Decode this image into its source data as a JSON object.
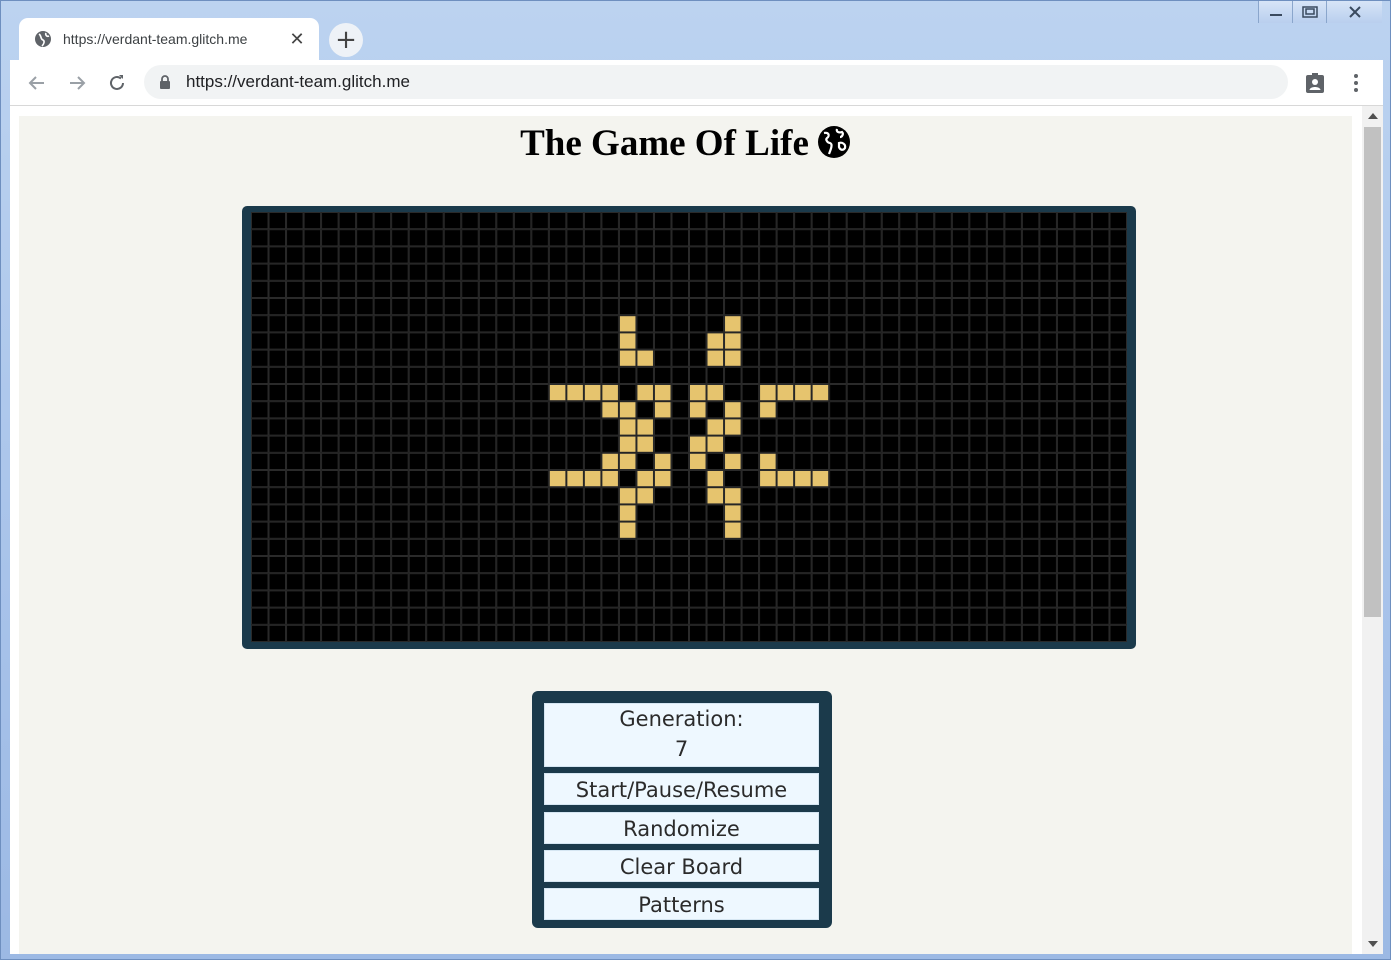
{
  "browser": {
    "tab_title": "https://verdant-team.glitch.me",
    "close_tab_glyph": "✕",
    "new_tab_glyph": "+",
    "url": "https://verdant-team.glitch.me",
    "icons": [
      "globe-icon",
      "back-arrow-icon",
      "forward-arrow-icon",
      "reload-icon",
      "lock-icon",
      "profile-icon",
      "menu-dots-icon",
      "close-icon",
      "minimize-icon",
      "maximize-icon"
    ]
  },
  "page": {
    "title": "The Game Of Life",
    "title_emoji": "🌏"
  },
  "board": {
    "cols": 50,
    "rows": 25,
    "live_color": "#e6c46e",
    "dead_color": "#000000",
    "grid_color": "#2a2a2a",
    "frame_color": "#1b3a4b",
    "live_cells": [
      [
        21,
        6
      ],
      [
        21,
        7
      ],
      [
        21,
        8
      ],
      [
        22,
        8
      ],
      [
        27,
        6
      ],
      [
        26,
        7
      ],
      [
        27,
        7
      ],
      [
        26,
        8
      ],
      [
        27,
        8
      ],
      [
        17,
        10
      ],
      [
        18,
        10
      ],
      [
        19,
        10
      ],
      [
        20,
        10
      ],
      [
        20,
        11
      ],
      [
        22,
        10
      ],
      [
        23,
        10
      ],
      [
        21,
        11
      ],
      [
        23,
        11
      ],
      [
        21,
        12
      ],
      [
        22,
        12
      ],
      [
        25,
        10
      ],
      [
        26,
        10
      ],
      [
        25,
        11
      ],
      [
        27,
        11
      ],
      [
        26,
        12
      ],
      [
        27,
        12
      ],
      [
        29,
        10
      ],
      [
        30,
        10
      ],
      [
        31,
        10
      ],
      [
        32,
        10
      ],
      [
        29,
        11
      ],
      [
        21,
        13
      ],
      [
        22,
        13
      ],
      [
        21,
        14
      ],
      [
        23,
        14
      ],
      [
        22,
        15
      ],
      [
        23,
        15
      ],
      [
        25,
        13
      ],
      [
        26,
        13
      ],
      [
        25,
        14
      ],
      [
        27,
        14
      ],
      [
        26,
        15
      ],
      [
        20,
        14
      ],
      [
        17,
        15
      ],
      [
        18,
        15
      ],
      [
        19,
        15
      ],
      [
        20,
        15
      ],
      [
        29,
        14
      ],
      [
        29,
        15
      ],
      [
        30,
        15
      ],
      [
        31,
        15
      ],
      [
        32,
        15
      ],
      [
        21,
        16
      ],
      [
        22,
        16
      ],
      [
        21,
        17
      ],
      [
        21,
        18
      ],
      [
        26,
        16
      ],
      [
        27,
        16
      ],
      [
        27,
        17
      ],
      [
        27,
        18
      ]
    ]
  },
  "controls": {
    "generation_label": "Generation:",
    "generation_value": "7",
    "start_label": "Start/Pause/Resume",
    "randomize_label": "Randomize",
    "clear_label": "Clear Board",
    "patterns_label": "Patterns"
  }
}
